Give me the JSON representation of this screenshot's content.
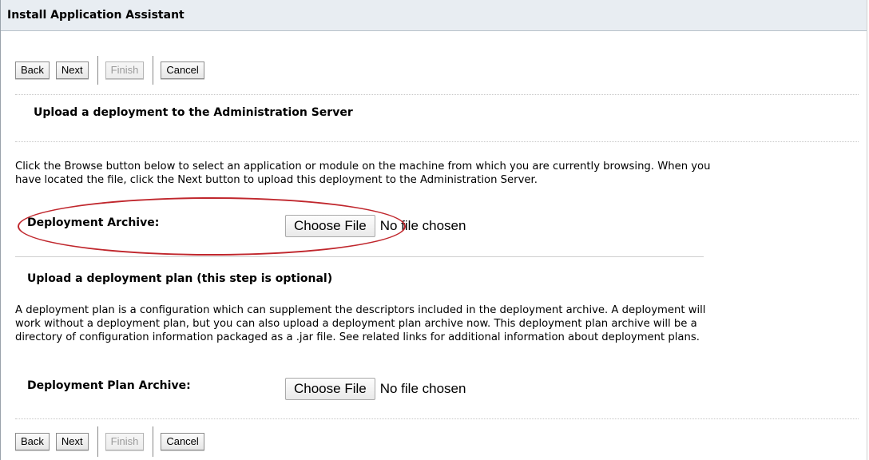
{
  "window": {
    "title": "Install Application Assistant"
  },
  "toolbar": {
    "back": "Back",
    "next": "Next",
    "finish": "Finish",
    "cancel": "Cancel"
  },
  "upload_archive": {
    "heading": "Upload a deployment to the Administration Server",
    "description_line1": "Click the Browse button below to select an application or module on the machine from which you are currently browsing. When you",
    "description_line2": "have located the file, click the Next button to upload this deployment to the Administration Server.",
    "field_label": "Deployment Archive:",
    "choose_label": "Choose File",
    "status": "No file chosen",
    "highlight_color": "#c0272d"
  },
  "upload_plan": {
    "heading": "Upload a deployment plan (this step is optional)",
    "description_line1": "A deployment plan is a configuration which can supplement the descriptors included in the deployment archive. A deployment will",
    "description_line2": "work without a deployment plan, but you can also upload a deployment plan archive now. This deployment plan archive will be a",
    "description_line3": "directory of configuration information packaged as a .jar file. See related links for additional information about deployment plans.",
    "field_label": "Deployment Plan Archive:",
    "choose_label": "Choose File",
    "status": "No file chosen"
  }
}
